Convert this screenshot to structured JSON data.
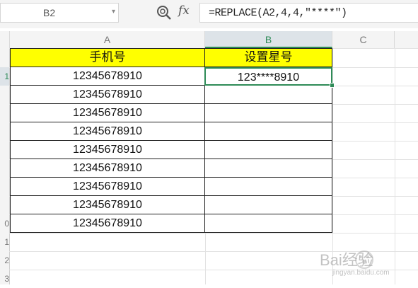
{
  "formula_bar": {
    "name_box": "B2",
    "fx_label": "fx",
    "formula": "=REPLACE(A2,4,4,\"****\")"
  },
  "columns": [
    "A",
    "B",
    "C"
  ],
  "rows": [
    "",
    "1",
    "",
    "",
    "",
    "",
    "",
    "",
    "",
    "0",
    "1",
    "2",
    "3"
  ],
  "sheet": {
    "header_row": [
      "手机号",
      "设置星号"
    ],
    "data_rows": [
      [
        "12345678910",
        "123****8910"
      ],
      [
        "12345678910",
        ""
      ],
      [
        "12345678910",
        ""
      ],
      [
        "12345678910",
        ""
      ],
      [
        "12345678910",
        ""
      ],
      [
        "12345678910",
        ""
      ],
      [
        "12345678910",
        ""
      ],
      [
        "12345678910",
        ""
      ],
      [
        "12345678910",
        ""
      ]
    ]
  },
  "selected_cell": "B2",
  "colors": {
    "header_fill": "#ffff00",
    "selection": "#2e8b57",
    "toolbar_bg": "#f4f4f4"
  },
  "watermark": {
    "text": "Bai经验",
    "sub": "jingyan.baidu.com"
  }
}
